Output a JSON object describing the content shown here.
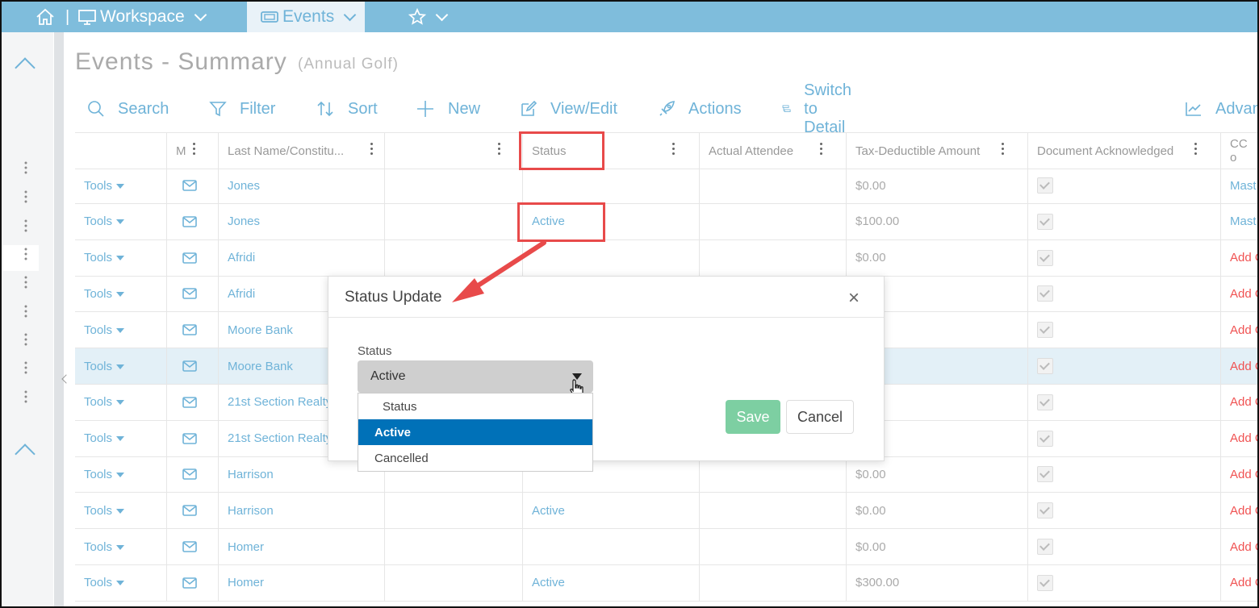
{
  "topbar": {
    "workspace_label": "Workspace",
    "events_label": "Events"
  },
  "page": {
    "title": "Events - Summary",
    "subtitle": "(Annual Golf)"
  },
  "toolbar": {
    "search": "Search",
    "filter": "Filter",
    "sort": "Sort",
    "new": "New",
    "view_edit": "View/Edit",
    "actions": "Actions",
    "switch_detail": "Switch to Detail",
    "advanced": "Advan"
  },
  "grid": {
    "headers": {
      "m": "M",
      "last_name": "Last Name/Constitu...",
      "blank": "",
      "status": "Status",
      "actual_attendee": "Actual Attendee",
      "tax": "Tax-Deductible Amount",
      "doc_ack": "Document Acknowledged",
      "cc": "CC o"
    },
    "tools_label": "Tools",
    "rows": [
      {
        "name": "Jones",
        "status": "",
        "amount": "$0.00",
        "cc": "Mast"
      },
      {
        "name": "Jones",
        "status": "Active",
        "amount": "$100.00",
        "cc": "Mast"
      },
      {
        "name": "Afridi",
        "status": "",
        "amount": "$0.00",
        "cc": "Add C"
      },
      {
        "name": "Afridi",
        "status": "",
        "amount": "",
        "cc": "Add C"
      },
      {
        "name": "Moore Bank",
        "status": "",
        "amount": "",
        "cc": "Add C"
      },
      {
        "name": "Moore Bank",
        "status": "",
        "amount": "",
        "cc": "Add C"
      },
      {
        "name": "21st Section Realty",
        "status": "",
        "amount": "",
        "cc": "Add C"
      },
      {
        "name": "21st Section Realty",
        "status": "",
        "amount": "",
        "cc": "Add C"
      },
      {
        "name": "Harrison",
        "status": "",
        "amount": "$0.00",
        "cc": "Add C"
      },
      {
        "name": "Harrison",
        "status": "Active",
        "amount": "$0.00",
        "cc": "Add C"
      },
      {
        "name": "Homer",
        "status": "",
        "amount": "$0.00",
        "cc": "Add C"
      },
      {
        "name": "Homer",
        "status": "Active",
        "amount": "$300.00",
        "cc": "Add C"
      }
    ]
  },
  "modal": {
    "title": "Status Update",
    "field_label": "Status",
    "selected_value": "Active",
    "options": [
      "Status",
      "Active",
      "Cancelled"
    ],
    "save": "Save",
    "cancel": "Cancel"
  },
  "colors": {
    "topbar": "#7fbddc",
    "link": "#6fb3d8",
    "selected_option": "#0071b8",
    "save_button": "#7dcfa2",
    "annotation": "#e84a4a"
  }
}
